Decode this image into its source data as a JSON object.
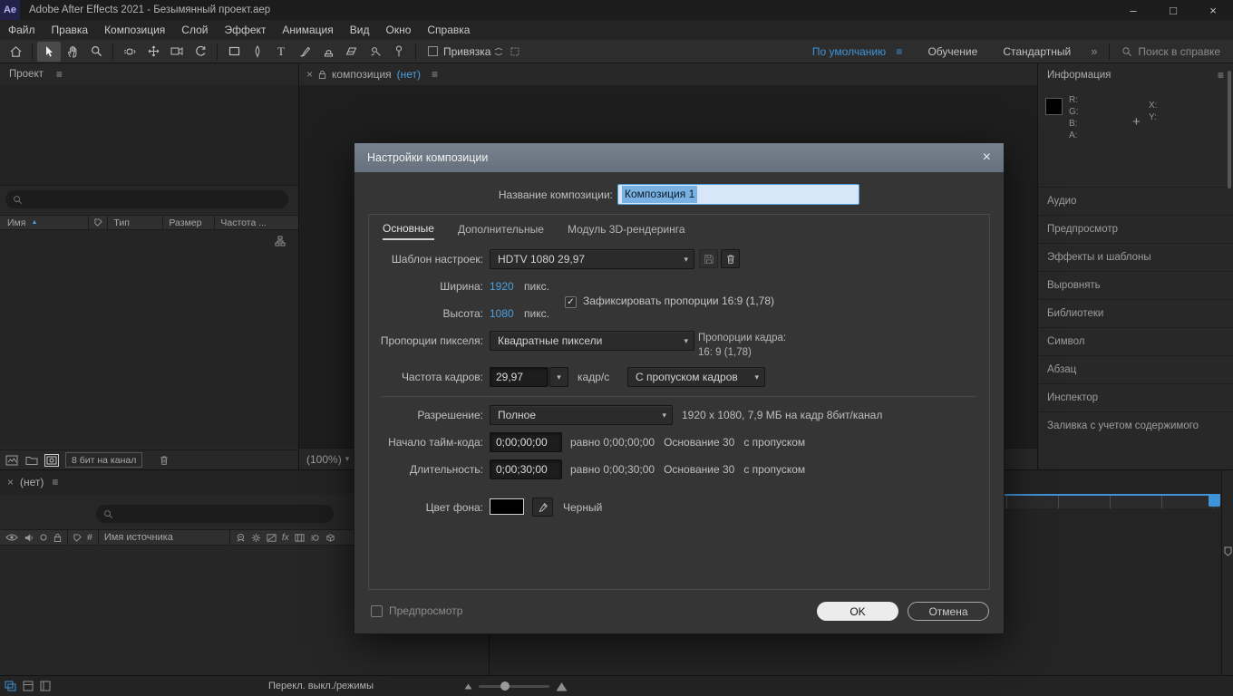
{
  "icons": {
    "menu": "≡",
    "chevron_down": "▾",
    "sort_asc": "▲",
    "crosshair": "+",
    "check": "✓",
    "double_chevron": "»"
  },
  "titlebar": {
    "logo": "Ae",
    "title": "Adobe After Effects 2021 - Безымянный проект.aep",
    "minimize": "–",
    "maximize": "□",
    "close": "×"
  },
  "menubar": {
    "items": [
      "Файл",
      "Правка",
      "Композиция",
      "Слой",
      "Эффект",
      "Анимация",
      "Вид",
      "Окно",
      "Справка"
    ]
  },
  "toolbar": {
    "snap_label": "Привязка",
    "workspaces": [
      "По умолчанию",
      "Обучение",
      "Стандартный"
    ],
    "search_placeholder": "Поиск в справке"
  },
  "project": {
    "title": "Проект",
    "col_name": "Имя",
    "col_type": "Тип",
    "col_size": "Размер",
    "col_rate": "Частота ...",
    "bit_depth": "8 бит на канал"
  },
  "comp": {
    "tab_close": "×",
    "tab_name": "композиция",
    "tab_state": "(нет)",
    "zoom": "(100%)"
  },
  "rightpanel": {
    "sections": [
      "Информация",
      "Аудио",
      "Предпросмотр",
      "Эффекты и шаблоны",
      "Выровнять",
      "Библиотеки",
      "Символ",
      "Абзац",
      "Инспектор",
      "Заливка с учетом содержимого"
    ],
    "r": "R:",
    "g": "G:",
    "b": "B:",
    "a": "A:",
    "x": "X:",
    "y": "Y:"
  },
  "timeline": {
    "tab_close": "×",
    "tab": "(нет)",
    "hash": "#",
    "source": "Имя источника",
    "fx": "fx",
    "modes_label": "Перекл. выкл./режимы"
  },
  "dialog": {
    "title": "Настройки композиции",
    "close": "×",
    "name_label": "Название композиции:",
    "name_value": "Композиция 1",
    "tabs": [
      "Основные",
      "Дополнительные",
      "Модуль 3D-рендеринга"
    ],
    "preset_label": "Шаблон настроек:",
    "preset_value": "HDTV 1080 29,97",
    "width_label": "Ширина:",
    "width_value": "1920",
    "width_unit": "пикс.",
    "lock_aspect": "Зафиксировать пропорции 16:9 (1,78)",
    "height_label": "Высота:",
    "height_value": "1080",
    "height_unit": "пикс.",
    "par_label": "Пропорции пикселя:",
    "par_value": "Квадратные пиксели",
    "frame_aspect_label": "Пропорции кадра:",
    "frame_aspect_value": "16: 9 (1,78)",
    "fps_label": "Частота кадров:",
    "fps_value": "29,97",
    "fps_unit": "кадр/с",
    "drop_value": "С пропуском кадров",
    "res_label": "Разрешение:",
    "res_value": "Полное",
    "res_info": "1920 x 1080, 7,9 МБ на кадр 8бит/канал",
    "start_label": "Начало тайм-кода:",
    "start_value": "0;00;00;00",
    "start_info": "равно 0;00;00;00   Основание 30   с пропуском",
    "dur_label": "Длительность:",
    "dur_value": "0;00;30;00",
    "dur_info": "равно 0;00;30;00   Основание 30   с пропуском",
    "bg_label": "Цвет фона:",
    "bg_name": "Черный",
    "preview_label": "Предпросмотр",
    "ok": "OK",
    "cancel": "Отмена"
  }
}
